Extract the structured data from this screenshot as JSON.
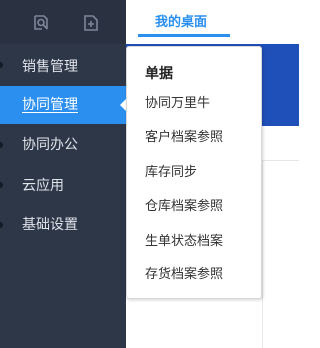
{
  "header": {
    "tab_label": "我的桌面",
    "icons": [
      "search-settings-icon",
      "add-document-icon"
    ]
  },
  "sidebar": {
    "items": [
      {
        "label": "销售管理",
        "active": false
      },
      {
        "label": "协同管理",
        "active": true
      },
      {
        "label": "协同办公",
        "active": false
      },
      {
        "label": "云应用",
        "active": false
      },
      {
        "label": "基础设置",
        "active": false
      }
    ]
  },
  "flyout": {
    "title": "单据",
    "items": [
      "协同万里牛",
      "客户档案参照",
      "库存同步",
      "仓库档案参照",
      "生单状态档案",
      "存货档案参照"
    ]
  },
  "colors": {
    "sidebar_bg": "#2e3748",
    "active_blue": "#2b8ff0",
    "banner_blue": "#1f4fb8"
  }
}
